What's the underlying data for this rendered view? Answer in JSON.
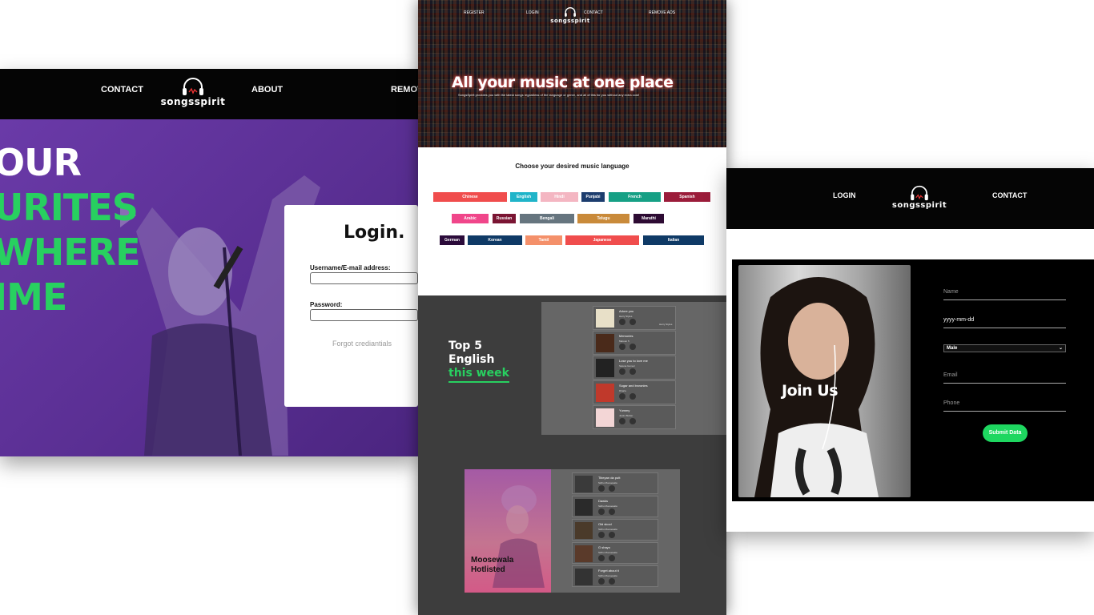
{
  "left": {
    "nav": {
      "contact": "CONTACT",
      "about": "ABOUT",
      "remove": "REMOV"
    },
    "logo_text": "songsspirit",
    "hero_lines": [
      "OUR",
      "URITES",
      "WHERE",
      "IME"
    ],
    "login": {
      "title": "Login.",
      "username_label": "Username/E-mail address:",
      "password_label": "Password:",
      "forgot": "Forgot crediantials"
    }
  },
  "center": {
    "nav": {
      "register": "REGISTER",
      "login": "LOGIN",
      "contact": "CONTACT",
      "remove_ads": "REMOVE ADS"
    },
    "logo_text": "songsspirit",
    "tagline": "All your music at one place",
    "subtagline": "SongsSpirit provides you with the latest songs regardless of the language or genre, and all of this for you without any extra cost!",
    "language_heading": "Choose your desired music language",
    "languages": [
      {
        "name": "Chinese",
        "color": "#f04d4d"
      },
      {
        "name": "English",
        "color": "#20b4c9"
      },
      {
        "name": "Hindi",
        "color": "#f4b6c2"
      },
      {
        "name": "Punjabi",
        "color": "#1c3d6e"
      },
      {
        "name": "French",
        "color": "#16a085"
      },
      {
        "name": "Spanish",
        "color": "#9b1c3a"
      },
      {
        "name": "Arabic",
        "color": "#f0468a"
      },
      {
        "name": "Russian",
        "color": "#7a1533"
      },
      {
        "name": "Bengali",
        "color": "#66757f"
      },
      {
        "name": "Telugu",
        "color": "#c98a3a"
      },
      {
        "name": "Marathi",
        "color": "#2d0b33"
      },
      {
        "name": "German",
        "color": "#2b0b3a"
      },
      {
        "name": "Korean",
        "color": "#0f3a66"
      },
      {
        "name": "Tamil",
        "color": "#f4906a"
      },
      {
        "name": "Japanese",
        "color": "#f04d4d"
      },
      {
        "name": "Italian",
        "color": "#0f3a66"
      }
    ],
    "top5": {
      "line1": "Top 5",
      "line2": "English",
      "line3": "this week"
    },
    "top5_songs": [
      {
        "title": "Adore you",
        "artist": "Harry Styles",
        "extra": "Harry Styles"
      },
      {
        "title": "Memories",
        "artist": "Maroon 5",
        "extra": ""
      },
      {
        "title": "Lose you to love me",
        "artist": "Selena Gomez",
        "extra": ""
      },
      {
        "title": "Sugar and brownies",
        "artist": "Dharia",
        "extra": ""
      },
      {
        "title": "Yummy",
        "artist": "Justin Bieber",
        "extra": ""
      }
    ],
    "hotlist": {
      "line1": "Moosewala",
      "line2": "Hotlisted"
    },
    "hot_songs": [
      {
        "title": "Tibeyan da putt",
        "artist": "Sidhu Moosewala"
      },
      {
        "title": "Dawks",
        "artist": "Sidhu Moosewala"
      },
      {
        "title": "Old skool",
        "artist": "Sidhu Moosewala"
      },
      {
        "title": "G shayo",
        "artist": "Sidhu Moosewala"
      },
      {
        "title": "Forget about it",
        "artist": "Sidhu Moosewala"
      }
    ]
  },
  "right": {
    "nav": {
      "login": "LOGIN",
      "contact": "CONTACT"
    },
    "logo_text": "songsspirit",
    "join_title": "Join Us",
    "form": {
      "name_placeholder": "Name",
      "dob_value": "yyyy-mm-dd",
      "gender_value": "Male",
      "email_placeholder": "Email",
      "phone_placeholder": "Phone",
      "submit": "Submit Data"
    }
  },
  "colors": {
    "accent_green": "#1ed760",
    "hero_purple": "#5a2f93"
  }
}
